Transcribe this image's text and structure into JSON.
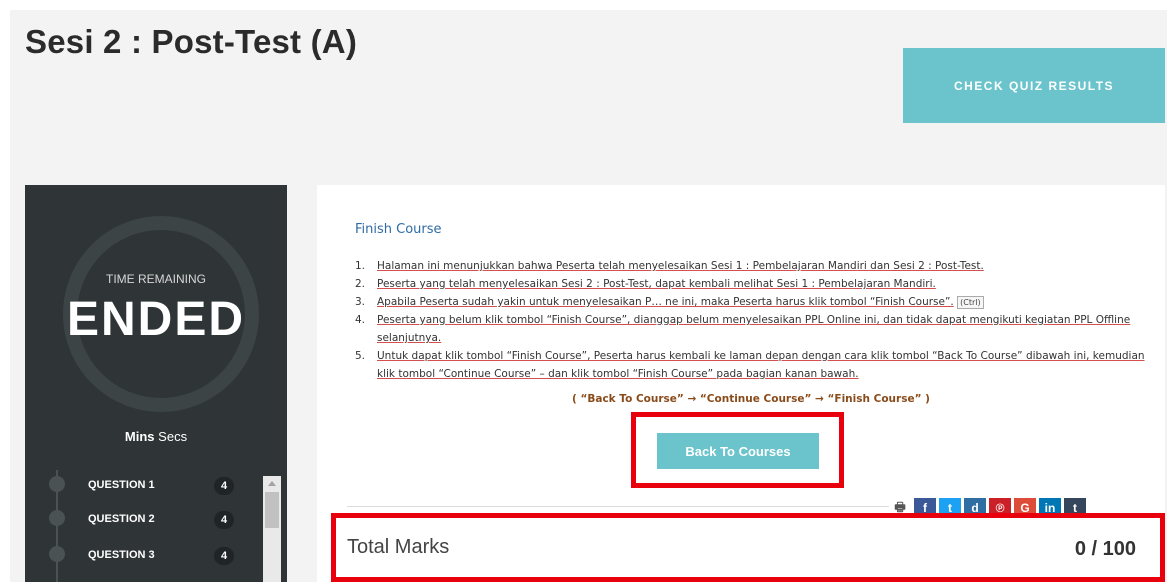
{
  "header": {
    "title": "Sesi 2 : Post-Test (A)",
    "check_button": "CHECK QUIZ RESULTS"
  },
  "timer": {
    "label": "TIME REMAINING",
    "status": "ENDED",
    "units_mins": "Mins",
    "units_secs": "Secs"
  },
  "questions": [
    {
      "label": "QUESTION 1",
      "count": "4"
    },
    {
      "label": "QUESTION 2",
      "count": "4"
    },
    {
      "label": "QUESTION 3",
      "count": "4"
    }
  ],
  "content": {
    "finish_title": "Finish Course",
    "steps": [
      {
        "num": "1.",
        "text": "Halaman ini menunjukkan bahwa Peserta telah menyelesaikan Sesi 1 : Pembelajaran Mandiri dan Sesi 2 : Post-Test."
      },
      {
        "num": "2.",
        "text": "Peserta yang telah menyelesaikan Sesi 2 : Post-Test, dapat kembali melihat Sesi 1 : Pembelajaran Mandiri."
      },
      {
        "num": "3.",
        "text": "Apabila Peserta sudah yakin untuk menyelesaikan P… ne ini, maka Peserta harus klik tombol “Finish Course”."
      },
      {
        "num": "4.",
        "text": "Peserta yang belum klik tombol “Finish Course”, dianggap belum menyelesaikan PPL Online ini, dan tidak dapat mengikuti kegiatan PPL Offline selanjutnya."
      },
      {
        "num": "5.",
        "text": "Untuk dapat klik tombol “Finish Course”, Peserta harus kembali ke laman depan dengan cara klik tombol “Back To Course” dibawah ini, kemudian klik tombol “Continue Course” – dan klik tombol “Finish Course” pada bagian kanan bawah."
      }
    ],
    "flow": "( “Back To Course” → “Continue Course” → “Finish Course” )",
    "paste_tag": "(Ctrl)",
    "back_button": "Back To Courses"
  },
  "share_icons": [
    "print-icon",
    "facebook-icon",
    "twitter-icon",
    "digg-icon",
    "pinterest-icon",
    "google-icon",
    "linkedin-icon",
    "tumblr-icon"
  ],
  "share_glyphs": [
    "🖶",
    "f",
    "t",
    "d",
    "℗",
    "G",
    "in",
    "t"
  ],
  "results": {
    "label": "Total Marks",
    "score": "0",
    "separator": "/",
    "max": "100"
  },
  "colors": {
    "accent": "#6bc4cc",
    "sidebar": "#2f3537",
    "highlight": "#e8000d"
  }
}
